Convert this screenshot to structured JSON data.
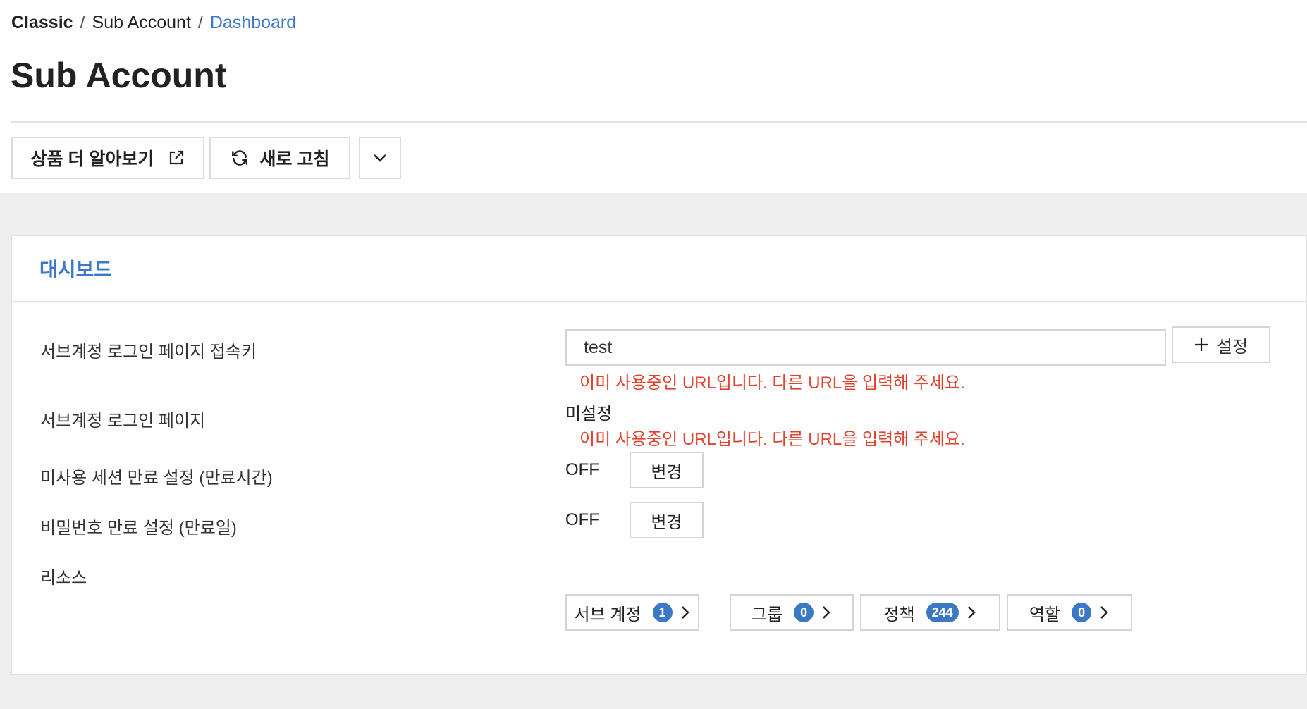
{
  "breadcrumb": [
    "Classic",
    "Sub Account",
    "Dashboard"
  ],
  "page_title": "Sub Account",
  "toolbar": {
    "learn_more": "상품 더 알아보기",
    "refresh": "새로 고침"
  },
  "dashboard": {
    "title": "대시보드",
    "login_key": {
      "label": "서브계정 로그인 페이지 접속키",
      "value": "test",
      "set_button": "설정",
      "error": "이미 사용중인 URL입니다. 다른 URL을 입력해 주세요."
    },
    "login_page": {
      "label": "서브계정 로그인 페이지",
      "value": "미설정",
      "error": "이미 사용중인 URL입니다. 다른 URL을 입력해 주세요."
    },
    "session_expiry": {
      "label": "미사용 세션 만료 설정 (만료시간)",
      "value": "OFF",
      "button": "변경"
    },
    "password_expiry": {
      "label": "비밀번호 만료 설정 (만료일)",
      "value": "OFF",
      "button": "변경"
    },
    "resources": {
      "label": "리소스",
      "items": [
        {
          "label": "서브 계정",
          "count": "1"
        },
        {
          "label": "그룹",
          "count": "0"
        },
        {
          "label": "정책",
          "count": "244"
        },
        {
          "label": "역할",
          "count": "0"
        }
      ]
    }
  },
  "colors": {
    "accent": "#3b78c6",
    "error": "#e0432f",
    "background": "#efefef"
  }
}
